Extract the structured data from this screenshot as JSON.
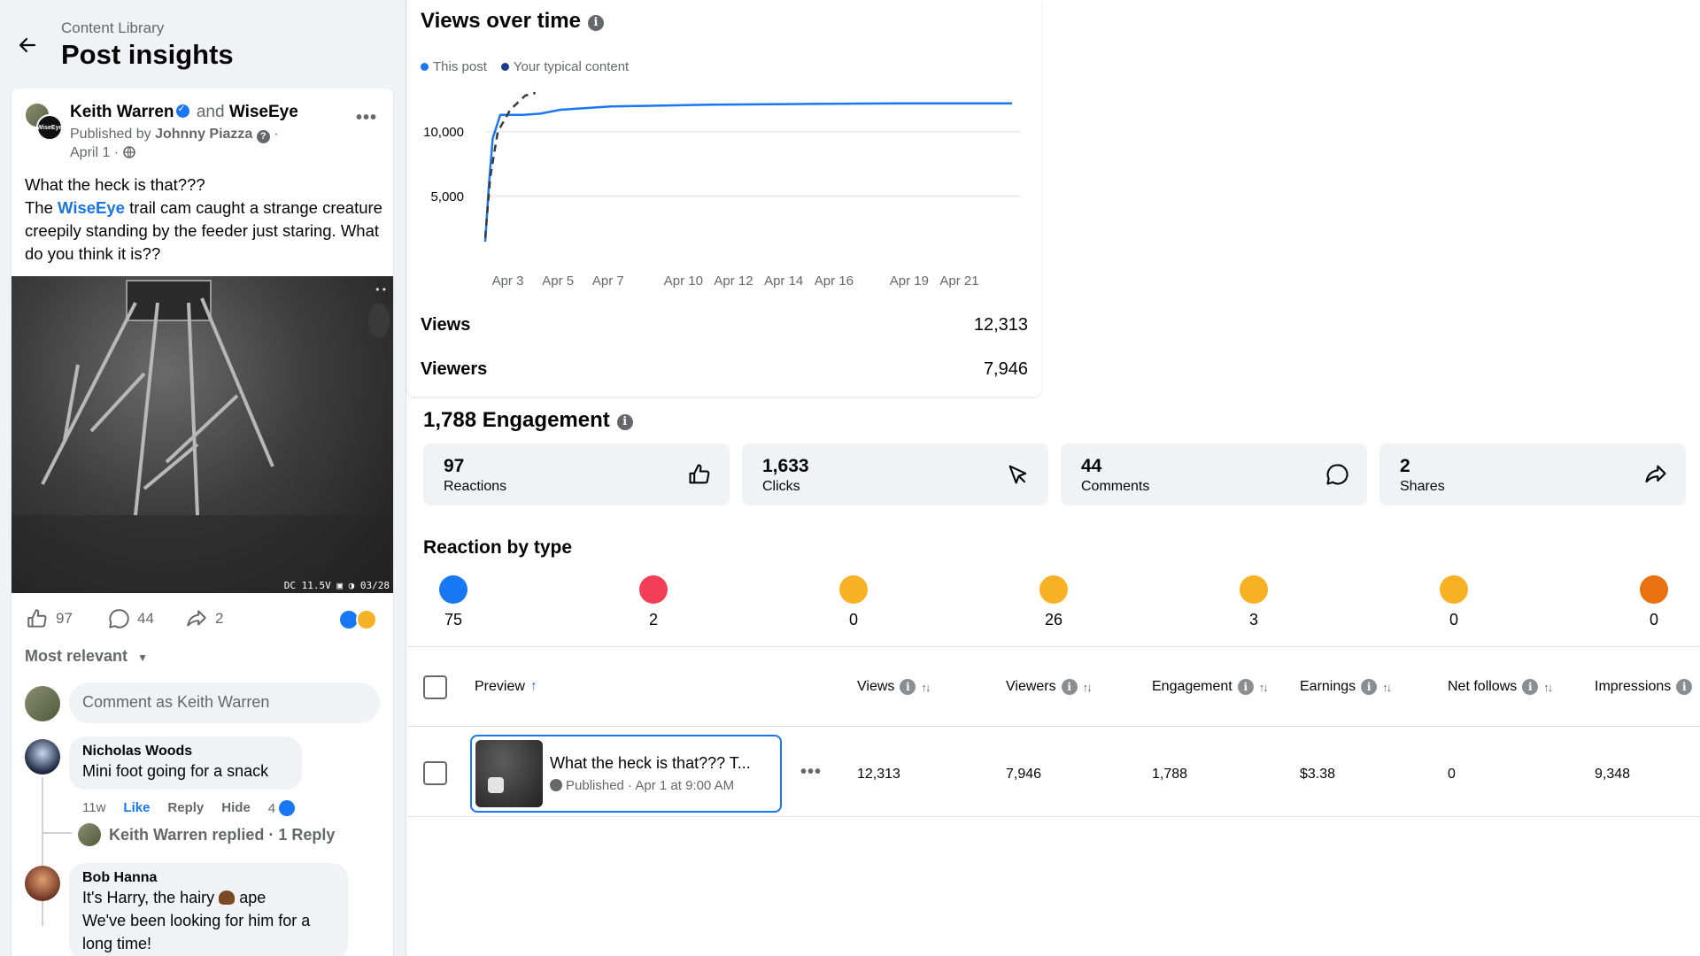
{
  "header": {
    "breadcrumb": "Content Library",
    "title": "Post insights"
  },
  "post": {
    "author": "Keith Warren",
    "and": "and",
    "page": "WiseEye",
    "avatar_text": "WiseEye",
    "published_prefix": "Published by",
    "publisher": "Johnny Piazza",
    "published_suffix": "·",
    "date": "April 1 ·",
    "text_line1": "What the heck is that???",
    "text_pre": "The",
    "text_link": "WiseEye",
    "text_post": "trail cam caught a strange creature creepily standing by the feeder just staring. What do you think it is??",
    "photo_stamp": "DC 11.5V ▣ ◑ 03/28",
    "reactions": "97",
    "comments": "44",
    "shares": "2"
  },
  "comments": {
    "sort_label": "Most relevant",
    "input_placeholder": "Comment as Keith Warren",
    "items": [
      {
        "name": "Nicholas Woods",
        "text": "Mini foot going for a snack",
        "time": "11w",
        "like": "Like",
        "reply": "Reply",
        "hide": "Hide",
        "reaction_count": "4",
        "replied_text": "Keith Warren replied · 1 Reply"
      },
      {
        "name": "Bob Hanna",
        "text_a": "It's Harry, the hairy",
        "text_b": "ape",
        "text_c": "We've been looking for him for a long time!"
      }
    ]
  },
  "views_over_time": {
    "title": "Views over time",
    "legend": [
      "This post",
      "Your typical content"
    ],
    "metrics": [
      {
        "label": "Views",
        "value": "12,313"
      },
      {
        "label": "Viewers",
        "value": "7,946"
      }
    ]
  },
  "chart_data": {
    "type": "line",
    "title": "Views over time",
    "x_tick_labels": [
      "Apr 3",
      "Apr 5",
      "Apr 7",
      "Apr 10",
      "Apr 12",
      "Apr 14",
      "Apr 16",
      "Apr 19",
      "Apr 21"
    ],
    "y_tick_labels": [
      "5,000",
      "10,000"
    ],
    "ylim": [
      0,
      13000
    ],
    "grid": true,
    "legend_position": "top-left",
    "series": [
      {
        "name": "This post",
        "color": "#1877f2",
        "style": "solid",
        "points": [
          [
            1,
            1500
          ],
          [
            1.15,
            6000
          ],
          [
            1.3,
            9500
          ],
          [
            1.6,
            11300
          ],
          [
            2.5,
            11300
          ],
          [
            3.2,
            11400
          ],
          [
            4,
            11700
          ],
          [
            6,
            11950
          ],
          [
            10,
            12100
          ],
          [
            14,
            12150
          ],
          [
            18,
            12200
          ],
          [
            22,
            12200
          ]
        ]
      },
      {
        "name": "Your typical content",
        "color": "#3a3b3c",
        "style": "dashed",
        "points": [
          [
            1,
            1800
          ],
          [
            1.2,
            6500
          ],
          [
            1.5,
            10000
          ],
          [
            2,
            11700
          ],
          [
            2.6,
            12800
          ],
          [
            3,
            13000
          ]
        ]
      }
    ]
  },
  "engagement": {
    "title": "1,788 Engagement",
    "cards": [
      {
        "value": "97",
        "label": "Reactions",
        "icon": "thumbs-up-icon"
      },
      {
        "value": "1,633",
        "label": "Clicks",
        "icon": "cursor-icon"
      },
      {
        "value": "44",
        "label": "Comments",
        "icon": "comment-icon"
      },
      {
        "value": "2",
        "label": "Shares",
        "icon": "share-icon"
      }
    ]
  },
  "reactions_by_type": {
    "title": "Reaction by type",
    "items": [
      {
        "name": "like",
        "count": "75",
        "color": "#1877f2"
      },
      {
        "name": "love",
        "count": "2",
        "color": "#f33e58"
      },
      {
        "name": "care",
        "count": "0",
        "color": "#f7b125"
      },
      {
        "name": "haha",
        "count": "26",
        "color": "#f7b125"
      },
      {
        "name": "wow",
        "count": "3",
        "color": "#f7b125"
      },
      {
        "name": "sad",
        "count": "0",
        "color": "#f7b125"
      },
      {
        "name": "angry",
        "count": "0",
        "color": "#e9710f"
      }
    ]
  },
  "table": {
    "columns": [
      "Preview",
      "Views",
      "Viewers",
      "Engagement",
      "Earnings",
      "Net follows",
      "Impressions"
    ],
    "row": {
      "title": "What the heck is that??? T...",
      "status": "Published · Apr 1 at 9:00 AM",
      "views": "12,313",
      "viewers": "7,946",
      "engagement": "1,788",
      "earnings": "$3.38",
      "net_follows": "0",
      "impressions": "9,348"
    }
  },
  "colors": {
    "accent": "#1877f2",
    "text": "#050505",
    "muted": "#65676b",
    "panel": "#f0f2f5"
  }
}
